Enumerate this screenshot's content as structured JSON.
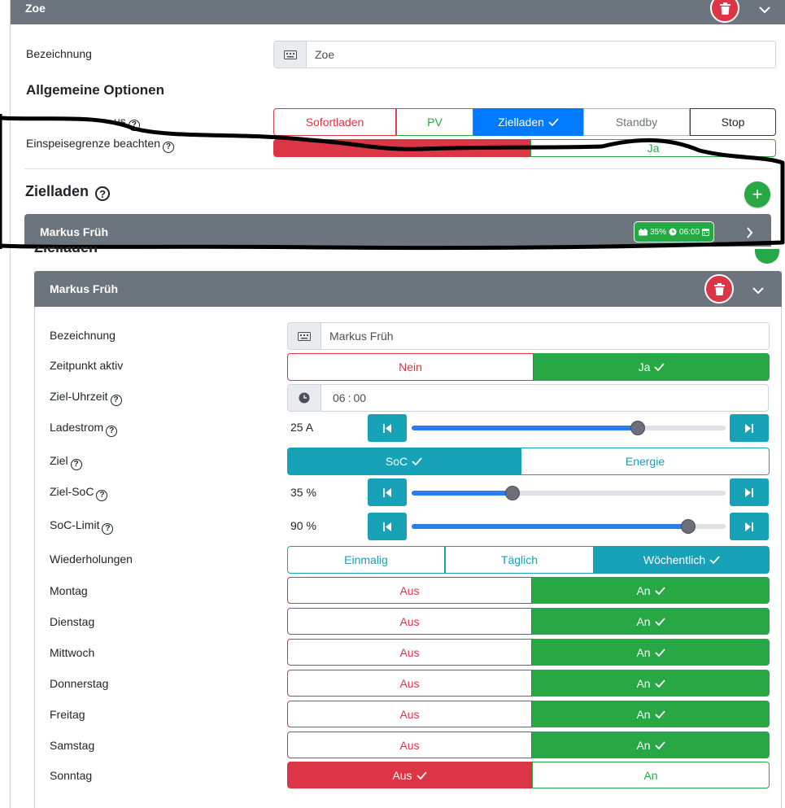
{
  "vehicle": {
    "title": "Zoe",
    "bezeichnung_label": "Bezeichnung",
    "bezeichnung_value": "Zoe",
    "options_title": "Allgemeine Optionen",
    "lademodus_label": "us",
    "lademodus_options": [
      "Sofortladen",
      "PV",
      "Zielladen",
      "Standby",
      "Stop"
    ],
    "lademodus_selected": "Zielladen",
    "einspeise_label": "Einspeisegrenze beachten",
    "einspeise_ja": "Ja"
  },
  "zielladen": {
    "title": "Zielladen",
    "collapsed_plan": {
      "name": "Markus Früh",
      "badge_soc": "35%",
      "badge_time": "06:00"
    }
  },
  "plan": {
    "title": "Markus Früh",
    "rows": {
      "bezeichnung_label": "Bezeichnung",
      "bezeichnung_value": "Markus Früh",
      "zeitpunkt_label": "Zeitpunkt aktiv",
      "zeitpunkt_nein": "Nein",
      "zeitpunkt_ja": "Ja",
      "zeit_label": "Ziel-Uhrzeit",
      "zeit_hh": "06",
      "zeit_mm": "00",
      "ladestrom_label": "Ladestrom",
      "ladestrom_value": "25 A",
      "ziel_label": "Ziel",
      "ziel_soc": "SoC",
      "ziel_energie": "Energie",
      "zielsoc_label": "Ziel-SoC",
      "zielsoc_value": "35 %",
      "soclimit_label": "SoC-Limit",
      "soclimit_value": "90 %",
      "wiederholung_label": "Wiederholungen",
      "wdh_einmalig": "Einmalig",
      "wdh_taeglich": "Täglich",
      "wdh_woechentlich": "Wöchentlich"
    },
    "sliders": {
      "ladestrom_fraction": 0.72,
      "zielsoc_fraction": 0.32,
      "soclimit_fraction": 0.88
    },
    "days": [
      {
        "name": "Montag",
        "aus": "Aus",
        "an": "An",
        "on": true
      },
      {
        "name": "Dienstag",
        "aus": "Aus",
        "an": "An",
        "on": true
      },
      {
        "name": "Mittwoch",
        "aus": "Aus",
        "an": "An",
        "on": true
      },
      {
        "name": "Donnerstag",
        "aus": "Aus",
        "an": "An",
        "on": true
      },
      {
        "name": "Freitag",
        "aus": "Aus",
        "an": "An",
        "on": true
      },
      {
        "name": "Samstag",
        "aus": "Aus",
        "an": "An",
        "on": true
      },
      {
        "name": "Sonntag",
        "aus": "Aus",
        "an": "An",
        "on": false
      }
    ]
  },
  "colors": {
    "header_gray": "#6c757d",
    "danger": "#dc3545",
    "success": "#28a745",
    "info": "#17a2b8",
    "primary": "#007bff"
  },
  "icons": [
    "trash-icon",
    "chevron-down-icon",
    "keyboard-icon",
    "help-icon",
    "plus-icon",
    "chevron-right-icon",
    "clock-icon",
    "step-start-icon",
    "step-end-icon",
    "check-icon",
    "calendar-icon",
    "car-battery-icon"
  ]
}
